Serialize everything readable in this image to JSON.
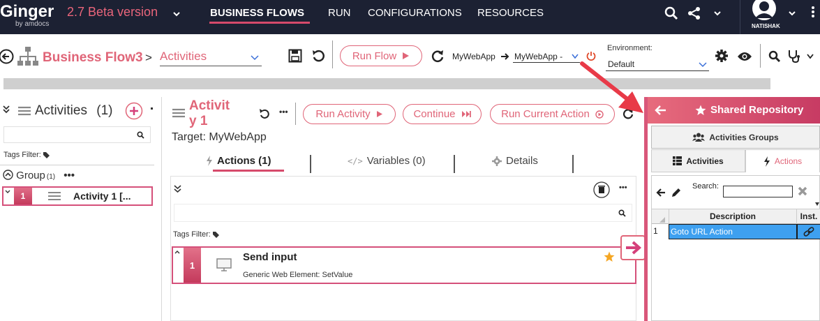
{
  "topbar": {
    "logo": "Ginger",
    "logo_sub": "by amdocs",
    "version": "2.7 Beta version",
    "nav": [
      "BUSINESS FLOWS",
      "RUN",
      "CONFIGURATIONS",
      "RESOURCES"
    ],
    "user": "NATISHAK"
  },
  "toolbar": {
    "business_flow": "Business Flow3",
    "separator": ">",
    "view_select": "Activities",
    "run_flow": "Run Flow",
    "app_name": "MyWebApp",
    "target_select": "MyWebApp -",
    "environment_label": "Environment:",
    "environment_value": "Default"
  },
  "left_panel": {
    "title": "Activities",
    "count": "(1)",
    "tags_filter": "Tags Filter:",
    "group_label": "Group",
    "group_count": "(1)",
    "activity": {
      "num": "1",
      "name": "Activity 1 [..."
    }
  },
  "center": {
    "activity_title": "Activit y 1",
    "run_activity": "Run Activity",
    "continue": "Continue",
    "run_current_action": "Run Current Action",
    "target": "Target: MyWebApp",
    "tabs": [
      {
        "label": "Actions (1)"
      },
      {
        "label": "Variables (0)"
      },
      {
        "label": "Details"
      }
    ],
    "tags_filter": "Tags Filter:",
    "action": {
      "num": "1",
      "name": "Send input",
      "desc": "Generic Web Element: SetValue"
    }
  },
  "shared_repo": {
    "title": "Shared Repository",
    "activities_groups": "Activities Groups",
    "tab_activities": "Activities",
    "tab_actions": "Actions",
    "search_label": "Search:",
    "columns": [
      "Description",
      "Inst."
    ],
    "rows": [
      {
        "num": "1",
        "desc": "Goto URL Action"
      }
    ]
  },
  "colors": {
    "accent": "#e06578",
    "topbar": "#1c2133",
    "selected_row": "#3ea0f0"
  }
}
